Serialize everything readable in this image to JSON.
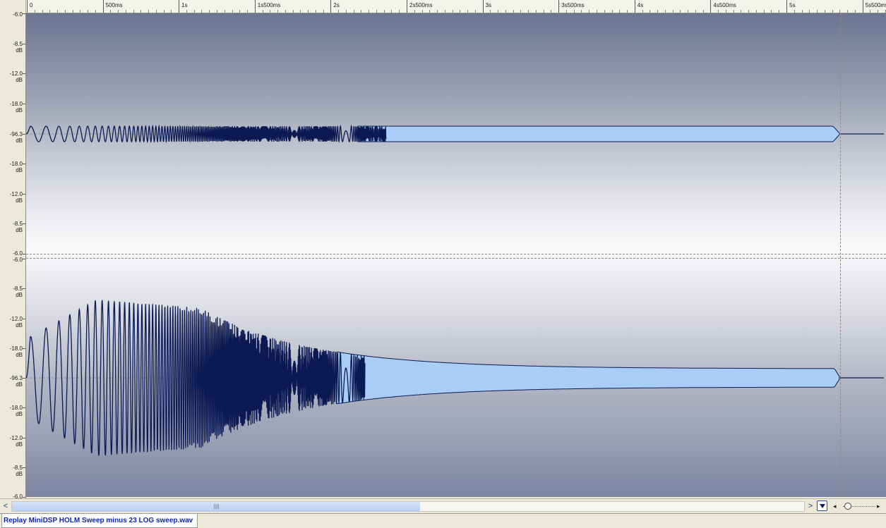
{
  "timeline": {
    "labels": [
      "0",
      "500ms",
      "1s",
      "1s500ms",
      "2s",
      "2s500ms",
      "3s",
      "3s500ms",
      "4s",
      "4s500ms",
      "5s",
      "5s500ms"
    ]
  },
  "channels": [
    {
      "name": "channel-1",
      "db_labels": [
        {
          "value": "-6.0",
          "unit": ""
        },
        {
          "value": "-8.5",
          "unit": "dB"
        },
        {
          "value": "-12.0",
          "unit": "dB"
        },
        {
          "value": "-18.0",
          "unit": "dB"
        },
        {
          "value": "-96.3",
          "unit": "dB"
        },
        {
          "value": "-18.0",
          "unit": "dB"
        },
        {
          "value": "-12.0",
          "unit": "dB"
        },
        {
          "value": "-8.5",
          "unit": "dB"
        },
        {
          "value": "-6.0",
          "unit": ""
        }
      ]
    },
    {
      "name": "channel-2",
      "db_labels": [
        {
          "value": "-6.0",
          "unit": ""
        },
        {
          "value": "-8.5",
          "unit": "dB"
        },
        {
          "value": "-12.0",
          "unit": "dB"
        },
        {
          "value": "-18.0",
          "unit": "dB"
        },
        {
          "value": "-96.3",
          "unit": "dB"
        },
        {
          "value": "-18.0",
          "unit": "dB"
        },
        {
          "value": "-12.0",
          "unit": "dB"
        },
        {
          "value": "-8.5",
          "unit": "dB"
        },
        {
          "value": "-6.0",
          "unit": ""
        }
      ]
    }
  ],
  "colors": {
    "waveform_stroke": "#0b1a52",
    "waveform_fill": "#a9cdf6"
  },
  "scrollbar": {
    "left_arrow": "<",
    "right_arrow": ">",
    "zoom_left": "◂",
    "zoom_right": "▸"
  },
  "tabs": {
    "file": "Replay MiniDSP HOLM Sweep minus 23 LOG sweep.wav"
  }
}
